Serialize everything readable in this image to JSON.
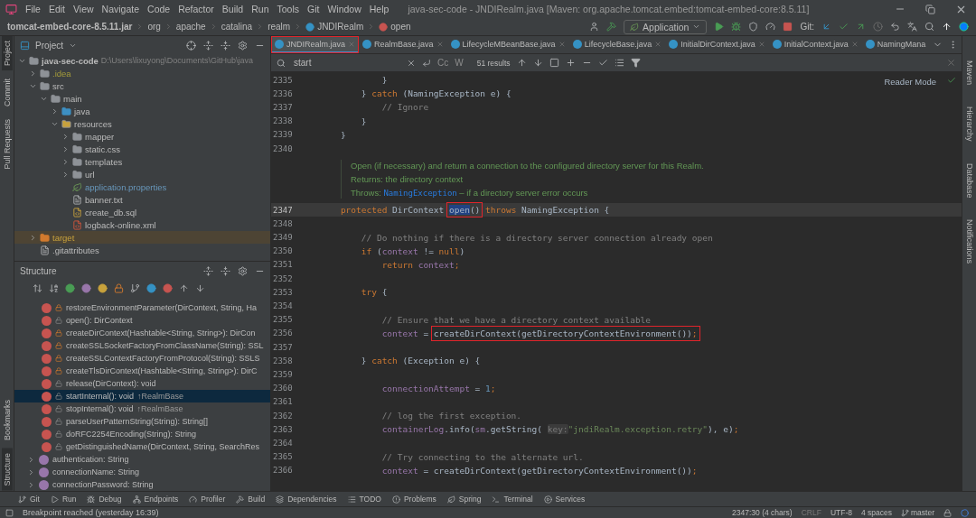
{
  "menu_bar": {
    "items": [
      "File",
      "Edit",
      "View",
      "Navigate",
      "Code",
      "Refactor",
      "Build",
      "Run",
      "Tools",
      "Git",
      "Window",
      "Help"
    ],
    "title": "java-sec-code - JNDIRealm.java [Maven: org.apache.tomcat.embed:tomcat-embed-core:8.5.11]"
  },
  "navigation_bar": {
    "breadcrumbs": [
      {
        "kind": "jar",
        "label": "tomcat-embed-core-8.5.11.jar"
      },
      {
        "kind": "package",
        "label": "org"
      },
      {
        "kind": "package",
        "label": "apache"
      },
      {
        "kind": "package",
        "label": "catalina"
      },
      {
        "kind": "package",
        "label": "realm"
      },
      {
        "kind": "class",
        "label": "JNDIRealm"
      },
      {
        "kind": "method",
        "label": "open"
      }
    ],
    "run_configuration": "Application",
    "git_label": "Git:"
  },
  "left_stripe": {
    "top": [
      {
        "label": "Project",
        "selected": true
      },
      {
        "label": "Commit",
        "selected": false
      },
      {
        "label": "Pull Requests",
        "selected": false
      }
    ],
    "bottom": [
      {
        "label": "Bookmarks",
        "selected": false
      },
      {
        "label": "Structure",
        "selected": true
      }
    ]
  },
  "project_panel": {
    "title": "Project",
    "tree": [
      {
        "name": "java-sec-code",
        "path": "D:\\Users\\lixuyong\\Documents\\GitHub\\java",
        "kind": "module",
        "expanded": true,
        "children": [
          {
            "name": ".idea",
            "kind": "ignored-folder",
            "expanded": false
          },
          {
            "name": "src",
            "kind": "folder",
            "expanded": true,
            "children": [
              {
                "name": "main",
                "kind": "folder",
                "expanded": true,
                "children": [
                  {
                    "name": "java",
                    "kind": "source-folder",
                    "expanded": false
                  },
                  {
                    "name": "resources",
                    "kind": "resource-folder",
                    "expanded": true,
                    "children": [
                      {
                        "name": "mapper",
                        "kind": "folder",
                        "expanded": false
                      },
                      {
                        "name": "static.css",
                        "kind": "folder",
                        "expanded": false
                      },
                      {
                        "name": "templates",
                        "kind": "folder",
                        "expanded": false
                      },
                      {
                        "name": "url",
                        "kind": "folder",
                        "expanded": false
                      },
                      {
                        "name": "application.properties",
                        "kind": "modified-config-file"
                      },
                      {
                        "name": "banner.txt",
                        "kind": "text-file"
                      },
                      {
                        "name": "create_db.sql",
                        "kind": "sql-file"
                      },
                      {
                        "name": "logback-online.xml",
                        "kind": "xml-file"
                      }
                    ]
                  }
                ]
              }
            ]
          },
          {
            "name": "target",
            "kind": "excluded-folder",
            "expanded": false
          },
          {
            "name": ".gitattributes",
            "kind": "text-file"
          }
        ]
      }
    ]
  },
  "structure_panel": {
    "title": "Structure",
    "items": [
      {
        "kind": "method",
        "private": true,
        "signature": "restoreEnvironmentParameter(DirContext, String, Ha",
        "selected": false
      },
      {
        "kind": "method",
        "private": false,
        "signature": "open(): DirContext",
        "selected": false
      },
      {
        "kind": "method",
        "private": true,
        "signature": "createDirContext(Hashtable<String, String>): DirCon",
        "selected": false
      },
      {
        "kind": "method",
        "private": true,
        "signature": "createSSLSocketFactoryFromClassName(String): SSL",
        "selected": false
      },
      {
        "kind": "method",
        "private": true,
        "signature": "createSSLContextFactoryFromProtocol(String): SSLS",
        "selected": false
      },
      {
        "kind": "method",
        "private": true,
        "signature": "createTlsDirContext(Hashtable<String, String>): DirC",
        "selected": false
      },
      {
        "kind": "method",
        "private": false,
        "signature": "release(DirContext): void",
        "selected": false
      },
      {
        "kind": "method",
        "private": false,
        "signature": "startInternal(): void",
        "inherited": "↑RealmBase",
        "selected": true
      },
      {
        "kind": "method",
        "private": false,
        "signature": "stopInternal(): void",
        "inherited": "↑RealmBase",
        "selected": false
      },
      {
        "kind": "method",
        "private": false,
        "signature": "parseUserPatternString(String): String[]",
        "selected": false
      },
      {
        "kind": "method",
        "private": false,
        "signature": "doRFC2254Encoding(String): String",
        "selected": false
      },
      {
        "kind": "method",
        "private": false,
        "signature": "getDistinguishedName(DirContext, String, SearchRes",
        "selected": false
      },
      {
        "kind": "property",
        "signature": "authentication: String",
        "expanded": false,
        "selected": false
      },
      {
        "kind": "property",
        "signature": "connectionName: String",
        "expanded": false,
        "selected": false
      },
      {
        "kind": "property",
        "signature": "connectionPassword: String",
        "expanded": false,
        "selected": false
      }
    ]
  },
  "editor": {
    "tabs": [
      {
        "label": "JNDIRealm.java",
        "selected": true,
        "annotated": true
      },
      {
        "label": "RealmBase.java",
        "selected": false,
        "annotated": false
      },
      {
        "label": "LifecycleMBeanBase.java",
        "selected": false,
        "annotated": false
      },
      {
        "label": "LifecycleBase.java",
        "selected": false,
        "annotated": false
      },
      {
        "label": "InitialDirContext.java",
        "selected": false,
        "annotated": false
      },
      {
        "label": "InitialContext.java",
        "selected": false,
        "annotated": false
      },
      {
        "label": "NamingMana",
        "selected": false,
        "annotated": false
      }
    ],
    "find_bar": {
      "query": "start",
      "toggles": [
        "Cc",
        "W"
      ],
      "results": "51 results"
    },
    "reader_mode": "Reader Mode",
    "lines": [
      {
        "kind": "code",
        "number": "2335",
        "current": false,
        "tokens": [
          {
            "kind": "plain",
            "text": "            }"
          }
        ]
      },
      {
        "kind": "code",
        "number": "2336",
        "current": false,
        "tokens": [
          {
            "kind": "plain",
            "text": "        } "
          },
          {
            "kind": "keyword",
            "text": "catch"
          },
          {
            "kind": "plain",
            "text": " (NamingException e) {"
          }
        ]
      },
      {
        "kind": "code",
        "number": "2337",
        "current": false,
        "tokens": [
          {
            "kind": "comment",
            "text": "            // Ignore"
          }
        ]
      },
      {
        "kind": "code",
        "number": "2338",
        "current": false,
        "tokens": [
          {
            "kind": "plain",
            "text": "        }"
          }
        ]
      },
      {
        "kind": "code",
        "number": "2339",
        "current": false,
        "tokens": [
          {
            "kind": "plain",
            "text": "    }"
          }
        ]
      },
      {
        "kind": "code",
        "number": "2340",
        "current": false
      },
      {
        "kind": "doc",
        "summary": "Open (if necessary) and return a connection to the configured directory server for this Realm.",
        "returns_label": "Returns:",
        "returns": "the directory context",
        "throws_label": "Throws:",
        "throws_type": "NamingException",
        "throws_text": "– if a directory server error occurs"
      },
      {
        "kind": "code",
        "number": "2347",
        "current": true,
        "tokens": [
          {
            "kind": "keyword",
            "text": "    protected"
          },
          {
            "kind": "plain",
            "text": " DirContext "
          },
          {
            "kind": "annotation",
            "tokens": [
              {
                "kind": "selected",
                "text": "open"
              },
              {
                "kind": "plain",
                "text": "()"
              }
            ]
          },
          {
            "kind": "keyword",
            "text": " throws"
          },
          {
            "kind": "plain",
            "text": " NamingException {"
          }
        ]
      },
      {
        "kind": "code",
        "number": "2348",
        "current": false
      },
      {
        "kind": "code",
        "number": "2349",
        "current": false,
        "tokens": [
          {
            "kind": "comment",
            "text": "        // Do nothing if there is a directory server connection already open"
          }
        ]
      },
      {
        "kind": "code",
        "number": "2350",
        "current": false,
        "tokens": [
          {
            "kind": "keyword",
            "text": "        if"
          },
          {
            "kind": "plain",
            "text": " ("
          },
          {
            "kind": "field",
            "text": "context"
          },
          {
            "kind": "plain",
            "text": " != "
          },
          {
            "kind": "keyword",
            "text": "null"
          },
          {
            "kind": "plain",
            "text": ")"
          }
        ]
      },
      {
        "kind": "code",
        "number": "2351",
        "current": false,
        "tokens": [
          {
            "kind": "keyword",
            "text": "            return"
          },
          {
            "kind": "field",
            "text": " context"
          },
          {
            "kind": "keyword",
            "text": ";"
          }
        ]
      },
      {
        "kind": "code",
        "number": "2352",
        "current": false
      },
      {
        "kind": "code",
        "number": "2353",
        "current": false,
        "tokens": [
          {
            "kind": "keyword",
            "text": "        try"
          },
          {
            "kind": "plain",
            "text": " {"
          }
        ]
      },
      {
        "kind": "code",
        "number": "2354",
        "current": false
      },
      {
        "kind": "code",
        "number": "2355",
        "current": false,
        "tokens": [
          {
            "kind": "comment",
            "text": "            // Ensure that we have a directory context available"
          }
        ]
      },
      {
        "kind": "code",
        "number": "2356",
        "current": false,
        "tokens": [
          {
            "kind": "field",
            "text": "            context"
          },
          {
            "kind": "plain",
            "text": " = "
          },
          {
            "kind": "annotation",
            "tokens": [
              {
                "kind": "plain",
                "text": "createDirContext(getDirectoryContextEnvironment())"
              },
              {
                "kind": "keyword",
                "text": ";"
              }
            ]
          }
        ]
      },
      {
        "kind": "code",
        "number": "2357",
        "current": false
      },
      {
        "kind": "code",
        "number": "2358",
        "current": false,
        "tokens": [
          {
            "kind": "plain",
            "text": "        } "
          },
          {
            "kind": "keyword",
            "text": "catch"
          },
          {
            "kind": "plain",
            "text": " (Exception e) {"
          }
        ]
      },
      {
        "kind": "code",
        "number": "2359",
        "current": false
      },
      {
        "kind": "code",
        "number": "2360",
        "current": false,
        "tokens": [
          {
            "kind": "field",
            "text": "            connectionAttempt"
          },
          {
            "kind": "plain",
            "text": " = "
          },
          {
            "kind": "number",
            "text": "1"
          },
          {
            "kind": "keyword",
            "text": ";"
          }
        ]
      },
      {
        "kind": "code",
        "number": "2361",
        "current": false
      },
      {
        "kind": "code",
        "number": "2362",
        "current": false,
        "tokens": [
          {
            "kind": "comment",
            "text": "            // log the first exception."
          }
        ]
      },
      {
        "kind": "code",
        "number": "2363",
        "current": false,
        "tokens": [
          {
            "kind": "field",
            "text": "            containerLog"
          },
          {
            "kind": "plain",
            "text": ".info("
          },
          {
            "kind": "field",
            "text": "sm"
          },
          {
            "kind": "plain",
            "text": ".getString( "
          },
          {
            "kind": "hint",
            "text": "key:"
          },
          {
            "kind": "string",
            "text": "\"jndiRealm.exception.retry\""
          },
          {
            "kind": "plain",
            "text": "), e)"
          },
          {
            "kind": "keyword",
            "text": ";"
          }
        ]
      },
      {
        "kind": "code",
        "number": "2364",
        "current": false
      },
      {
        "kind": "code",
        "number": "2365",
        "current": false,
        "tokens": [
          {
            "kind": "comment",
            "text": "            // Try connecting to the alternate url."
          }
        ]
      },
      {
        "kind": "code",
        "number": "2366",
        "current": false,
        "tokens": [
          {
            "kind": "field",
            "text": "            context"
          },
          {
            "kind": "plain",
            "text": " = createDirContext(getDirectoryContextEnvironment())"
          },
          {
            "kind": "keyword",
            "text": ";"
          }
        ]
      }
    ]
  },
  "right_stripe": [
    {
      "label": "Maven"
    },
    {
      "label": "Hierarchy"
    },
    {
      "label": "Database"
    },
    {
      "label": "Notifications"
    }
  ],
  "tool_windows": [
    {
      "kind": "git",
      "label": "Git"
    },
    {
      "kind": "run",
      "label": "Run"
    },
    {
      "kind": "debug",
      "label": "Debug"
    },
    {
      "kind": "endpoints",
      "label": "Endpoints"
    },
    {
      "kind": "profiler",
      "label": "Profiler"
    },
    {
      "kind": "build",
      "label": "Build"
    },
    {
      "kind": "dependencies",
      "label": "Dependencies"
    },
    {
      "kind": "todo",
      "label": "TODO"
    },
    {
      "kind": "problems",
      "label": "Problems"
    },
    {
      "kind": "spring",
      "label": "Spring"
    },
    {
      "kind": "terminal",
      "label": "Terminal"
    },
    {
      "kind": "services",
      "label": "Services"
    }
  ],
  "status_bar": {
    "message": "Breakpoint reached (yesterday 16:39)",
    "items": [
      {
        "kind": "position",
        "label": "2347:30 (4 chars)"
      },
      {
        "kind": "line-separator",
        "label": "CRLF"
      },
      {
        "kind": "encoding",
        "label": "UTF-8"
      },
      {
        "kind": "indent",
        "label": "4 spaces"
      },
      {
        "kind": "branch",
        "label": "master"
      }
    ]
  }
}
